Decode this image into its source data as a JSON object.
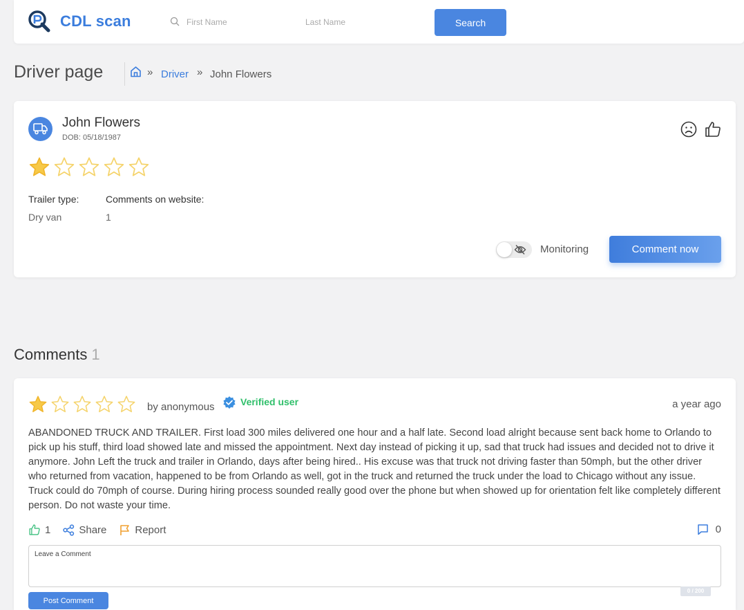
{
  "header": {
    "logo_text": "CDL scan",
    "first_name_placeholder": "First Name",
    "last_name_placeholder": "Last Name",
    "search_label": "Search"
  },
  "page": {
    "title": "Driver page",
    "breadcrumb": {
      "sep": "»",
      "driver": "Driver",
      "current": "John Flowers"
    }
  },
  "driver": {
    "name": "John Flowers",
    "dob": "DOB: 05/18/1987",
    "rating": 1,
    "rating_max": 5,
    "trailer_type_label": "Trailer type:",
    "trailer_type": "Dry van",
    "comments_label": "Comments on website:",
    "comments_count": "1",
    "monitoring_label": "Monitoring",
    "monitoring_on": false,
    "comment_now_label": "Comment now"
  },
  "comments": {
    "heading": "Comments",
    "count": "1",
    "items": [
      {
        "rating": 1,
        "rating_max": 5,
        "author": "by anonymous",
        "verified": "Verified user",
        "time": "a year ago",
        "body": "ABANDONED TRUCK AND TRAILER. First load 300 miles delivered one hour and a half late. Second load alright because sent back home to Orlando to pick up his stuff, third load showed late and missed the appointment. Next day instead of picking it up, sad that truck had issues and decided not to drive it anymore. John Left the truck and trailer in Orlando, days after being hired.. His excuse was that truck not driving faster than 50mph, but the other driver who returned from vacation, happened to be from Orlando as well, got in the truck and returned the truck under the load to Chicago without any issue. Truck could do 70mph of course. During hiring process sounded really good over the phone but when showed up for orientation felt like completely different person. Do not waste your time.",
        "likes": "1",
        "share_label": "Share",
        "report_label": "Report",
        "replies": "0",
        "leave_label": "Leave a Comment",
        "char_counter": "0 / 200",
        "post_label": "Post Comment"
      }
    ]
  },
  "colors": {
    "accent": "#4a86e0",
    "star_filled": "#f7c948",
    "star_empty": "#f5d36a",
    "verified": "#2fbf6a",
    "like_green": "#3fbf7f",
    "report_orange": "#f0a030"
  },
  "icons": [
    "logo-icon",
    "search-icon",
    "home-icon",
    "truck-icon",
    "sad-face-icon",
    "thumbs-up-icon",
    "eye-off-icon",
    "star-icon",
    "verified-badge-icon",
    "share-icon",
    "flag-icon",
    "comment-bubble-icon"
  ]
}
